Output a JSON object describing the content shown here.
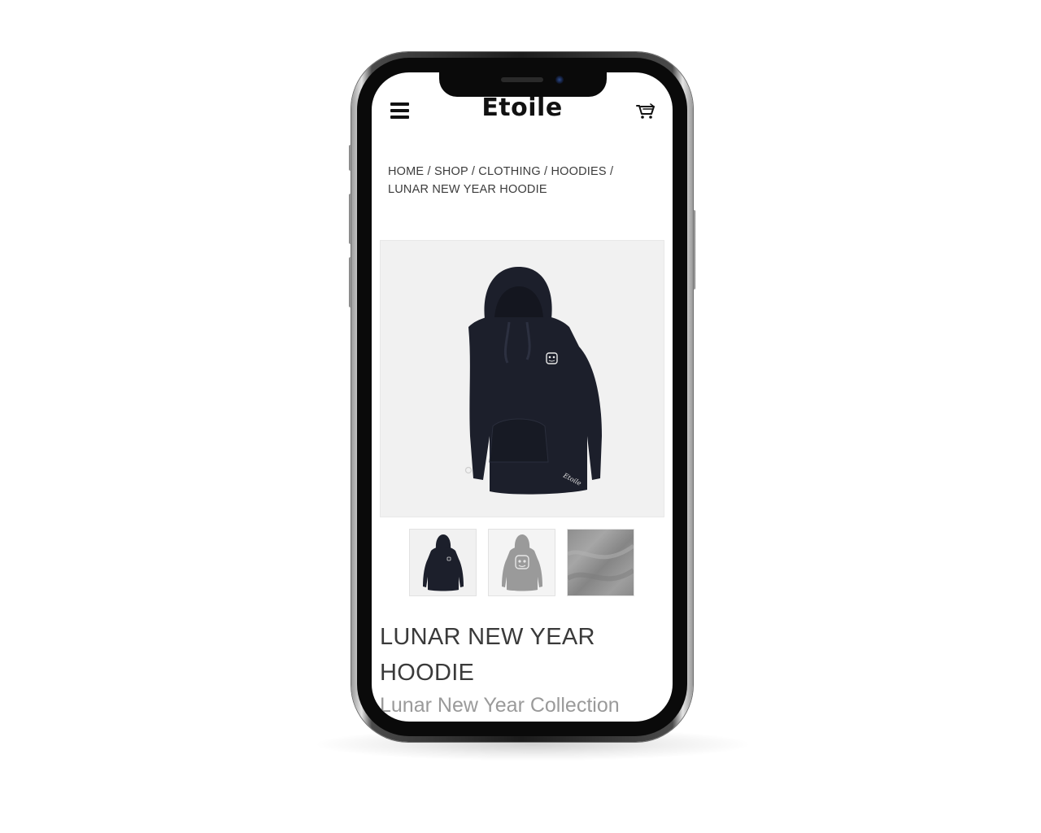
{
  "header": {
    "brand": "Etoile",
    "menu_icon": "hamburger-menu-icon",
    "cart_icon": "shopping-cart-icon"
  },
  "breadcrumb": "HOME / SHOP / CLOTHING / HOODIES / LUNAR NEW YEAR HOODIE",
  "product": {
    "title": "LUNAR NEW YEAR HOODIE",
    "collection": "Lunar New Year Collection",
    "sleeve_print": "Etoile",
    "hoodie_color": "#1c1f2b",
    "image_background": "#f1f1f1",
    "gallery": [
      {
        "label": "navy hoodie front thumbnail"
      },
      {
        "label": "grey hoodie back print thumbnail"
      },
      {
        "label": "fabric texture close-up thumbnail"
      }
    ]
  }
}
